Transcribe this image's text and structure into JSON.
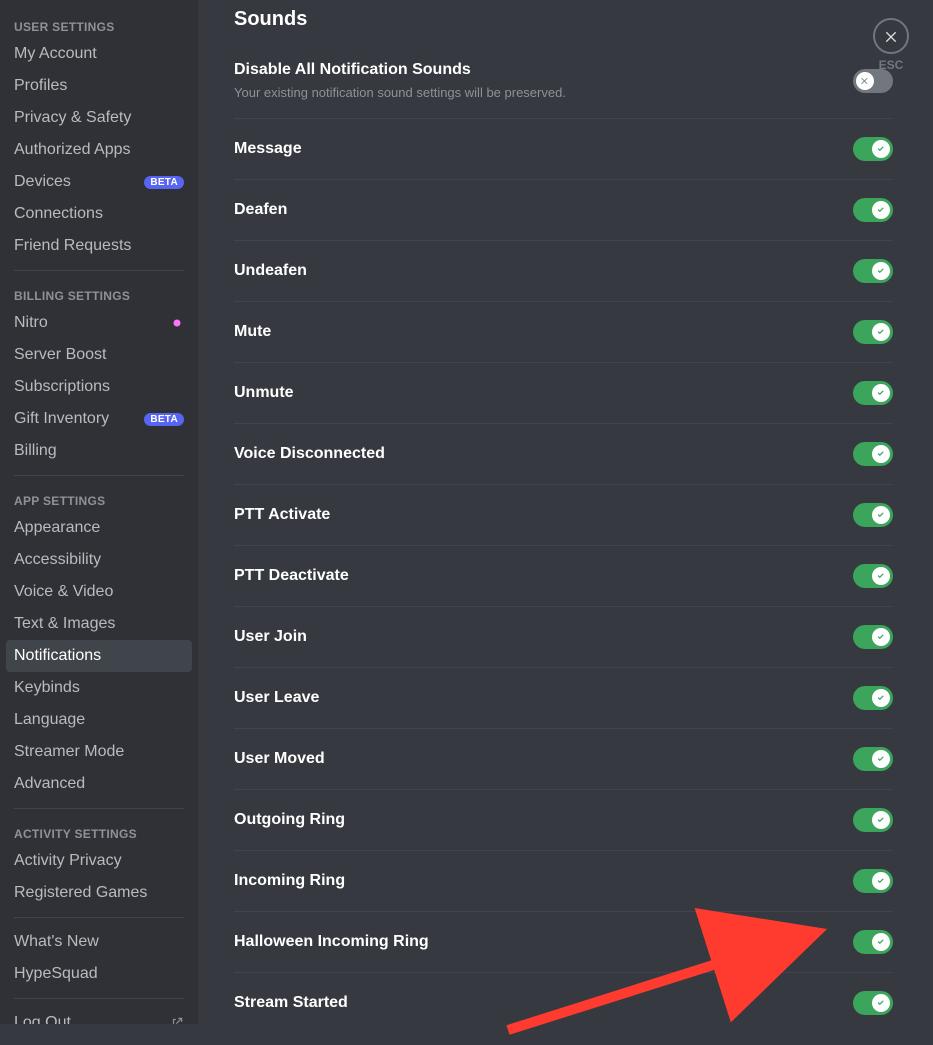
{
  "close_label": "ESC",
  "sidebar": {
    "sections": [
      {
        "header": "USER SETTINGS",
        "items": [
          {
            "label": "My Account"
          },
          {
            "label": "Profiles"
          },
          {
            "label": "Privacy & Safety"
          },
          {
            "label": "Authorized Apps"
          },
          {
            "label": "Devices",
            "badge": "BETA"
          },
          {
            "label": "Connections"
          },
          {
            "label": "Friend Requests"
          }
        ]
      },
      {
        "header": "BILLING SETTINGS",
        "items": [
          {
            "label": "Nitro",
            "nitro": true
          },
          {
            "label": "Server Boost"
          },
          {
            "label": "Subscriptions"
          },
          {
            "label": "Gift Inventory",
            "badge": "BETA"
          },
          {
            "label": "Billing"
          }
        ]
      },
      {
        "header": "APP SETTINGS",
        "items": [
          {
            "label": "Appearance"
          },
          {
            "label": "Accessibility"
          },
          {
            "label": "Voice & Video"
          },
          {
            "label": "Text & Images"
          },
          {
            "label": "Notifications",
            "selected": true
          },
          {
            "label": "Keybinds"
          },
          {
            "label": "Language"
          },
          {
            "label": "Streamer Mode"
          },
          {
            "label": "Advanced"
          }
        ]
      },
      {
        "header": "ACTIVITY SETTINGS",
        "items": [
          {
            "label": "Activity Privacy"
          },
          {
            "label": "Registered Games"
          }
        ]
      },
      {
        "header": "",
        "items": [
          {
            "label": "What's New"
          },
          {
            "label": "HypeSquad"
          }
        ]
      },
      {
        "header": "",
        "items": [
          {
            "label": "Log Out",
            "open": true
          }
        ]
      }
    ]
  },
  "main": {
    "section_title": "Sounds",
    "disable_all": {
      "label": "Disable All Notification Sounds",
      "desc": "Your existing notification sound settings will be preserved.",
      "on": false
    },
    "rows": [
      {
        "label": "Message",
        "on": true
      },
      {
        "label": "Deafen",
        "on": true
      },
      {
        "label": "Undeafen",
        "on": true
      },
      {
        "label": "Mute",
        "on": true
      },
      {
        "label": "Unmute",
        "on": true
      },
      {
        "label": "Voice Disconnected",
        "on": true
      },
      {
        "label": "PTT Activate",
        "on": true
      },
      {
        "label": "PTT Deactivate",
        "on": true
      },
      {
        "label": "User Join",
        "on": true
      },
      {
        "label": "User Leave",
        "on": true
      },
      {
        "label": "User Moved",
        "on": true
      },
      {
        "label": "Outgoing Ring",
        "on": true
      },
      {
        "label": "Incoming Ring",
        "on": true
      },
      {
        "label": "Halloween Incoming Ring",
        "on": true
      },
      {
        "label": "Stream Started",
        "on": true
      }
    ]
  }
}
